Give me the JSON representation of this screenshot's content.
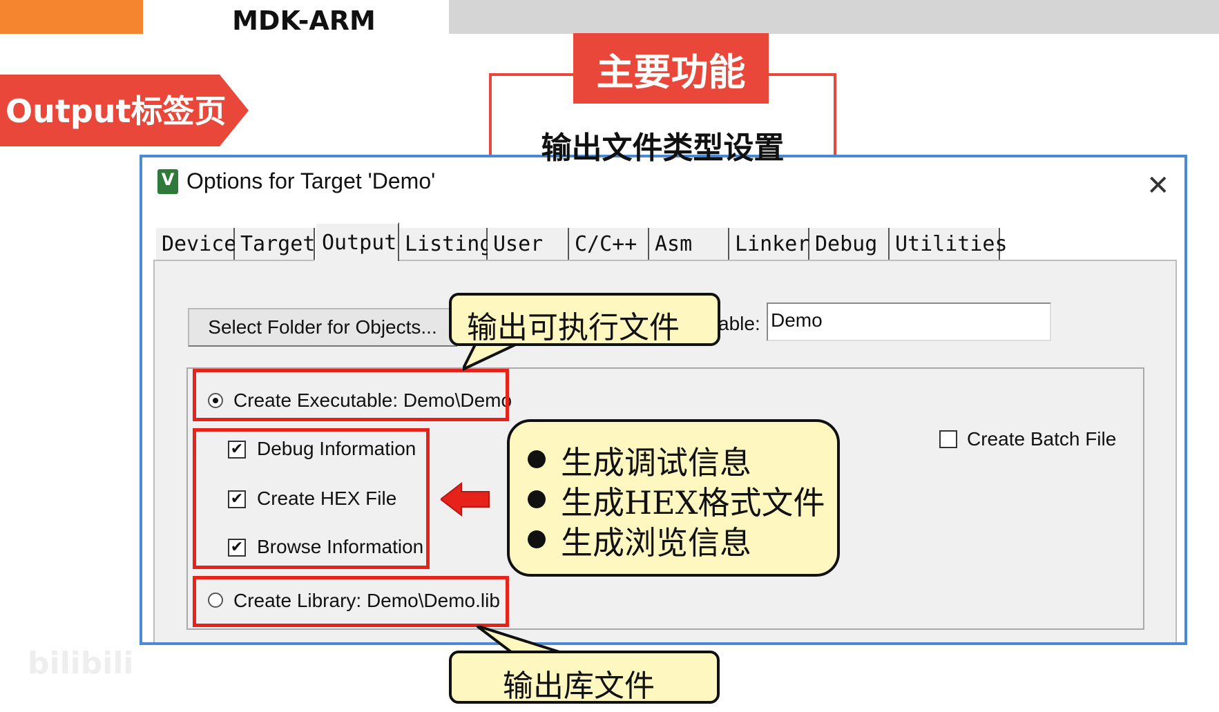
{
  "slide": {
    "title": "MDK-ARM",
    "section_label": "Output标签页",
    "main_function_header": "主要功能",
    "main_function_desc": "输出文件类型设置"
  },
  "dialog": {
    "title": "Options for Target 'Demo'",
    "icon_letter": "V",
    "close_glyph": "✕",
    "tabs": [
      {
        "label": "Device"
      },
      {
        "label": "Target"
      },
      {
        "label": "Output"
      },
      {
        "label": "Listing"
      },
      {
        "label": "User"
      },
      {
        "label": "C/C++"
      },
      {
        "label": "Asm"
      },
      {
        "label": "Linker"
      },
      {
        "label": "Debug"
      },
      {
        "label": "Utilities"
      }
    ],
    "active_tab": "Output",
    "select_folder_label": "Select Folder for Objects...",
    "exe_name_label_visible": "able:",
    "exe_name_value": "Demo",
    "create_executable_label": "Create Executable:  Demo\\Demo",
    "create_executable_selected": true,
    "debug_information_label": "Debug Information",
    "debug_information_checked": true,
    "create_hex_label": "Create HEX File",
    "create_hex_checked": true,
    "browse_information_label": "Browse Information",
    "browse_information_checked": true,
    "create_library_label": "Create Library:  Demo\\Demo.lib",
    "create_library_selected": false,
    "create_batch_label": "Create Batch File",
    "create_batch_checked": false
  },
  "callouts": {
    "executable": "输出可执行文件",
    "library": "输出库文件",
    "bullets": [
      "生成调试信息",
      "生成HEX格式文件",
      "生成浏览信息"
    ]
  },
  "watermark": "bilibili",
  "colors": {
    "accent_red": "#e8473a",
    "highlight_red": "#e5231b",
    "header_orange": "#f5862f",
    "dialog_border": "#4a8ad4",
    "callout_fill": "#fff7c0"
  }
}
